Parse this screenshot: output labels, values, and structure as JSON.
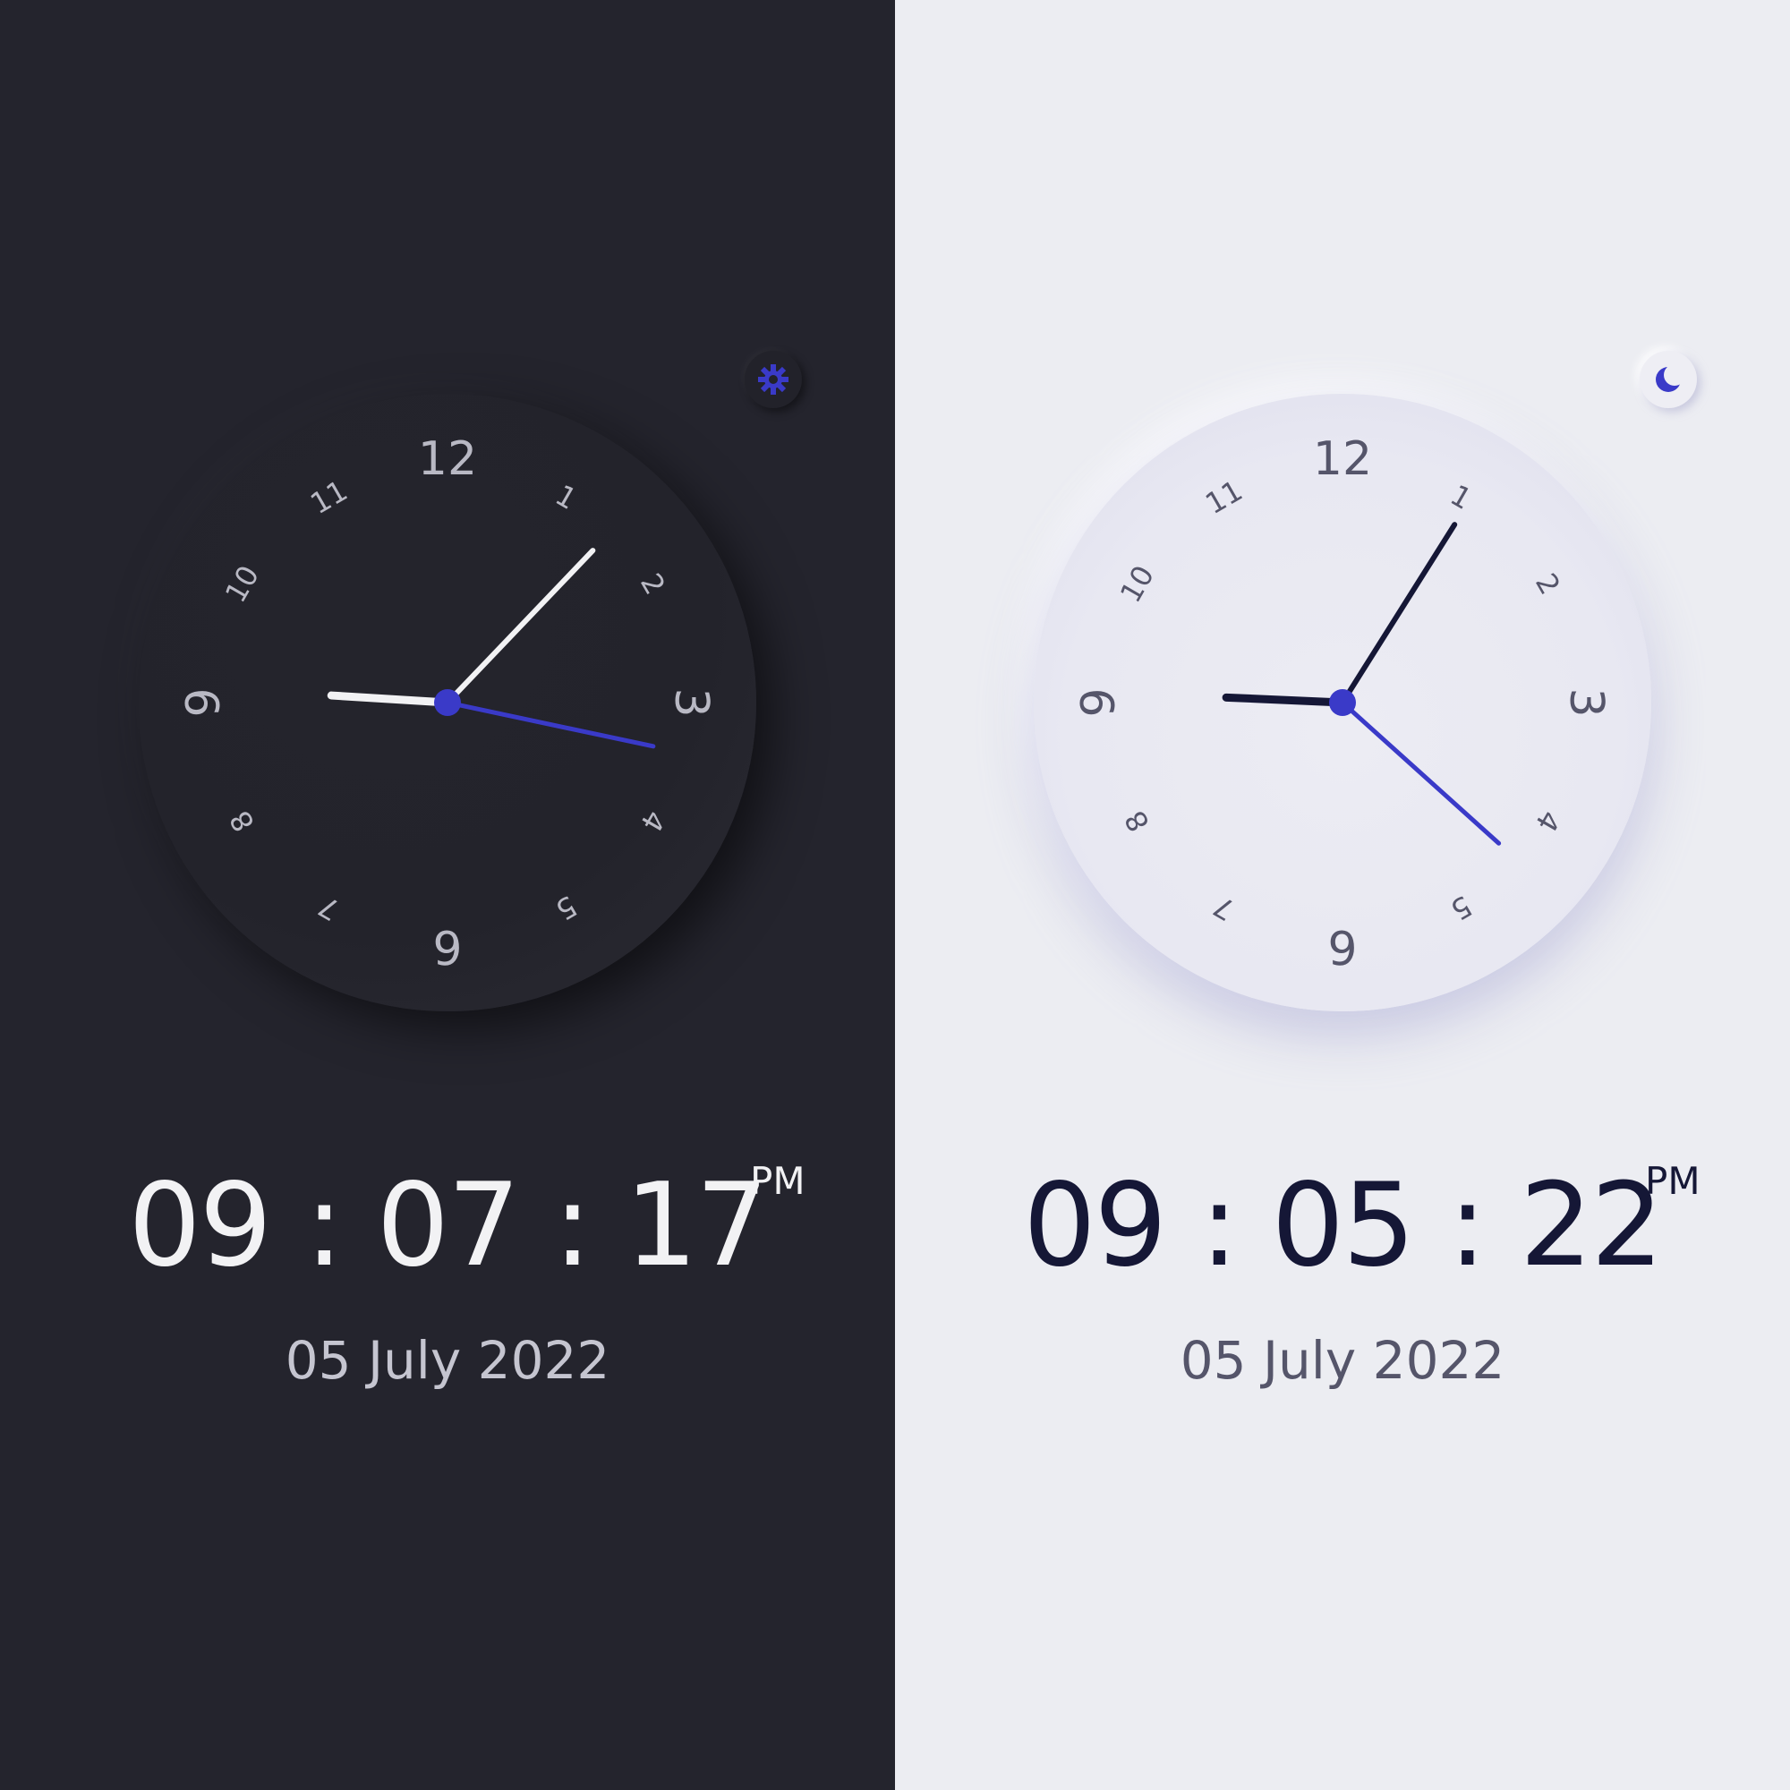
{
  "colors": {
    "accent": "#3a3ac8",
    "dark_bg": "#24242d",
    "light_bg": "#ecedf2",
    "dark_hand": "#f2f2f4",
    "light_hand": "#151736",
    "dark_numeral": "#b9b9c4",
    "light_numeral": "#55556a"
  },
  "dial_numerals": [
    "12",
    "1",
    "2",
    "3",
    "4",
    "5",
    "6",
    "7",
    "8",
    "9",
    "10",
    "11"
  ],
  "panels": [
    {
      "theme": "dark",
      "toggle_icon": "sun-icon",
      "time": {
        "hours": "09",
        "minutes": "07",
        "seconds": "17"
      },
      "ampm": "PM",
      "date": "05 July 2022",
      "analog": {
        "hour": 9,
        "minute": 7,
        "second": 17
      }
    },
    {
      "theme": "light",
      "toggle_icon": "moon-icon",
      "time": {
        "hours": "09",
        "minutes": "05",
        "seconds": "22"
      },
      "ampm": "PM",
      "date": "05 July 2022",
      "analog": {
        "hour": 9,
        "minute": 5,
        "second": 22
      }
    }
  ]
}
